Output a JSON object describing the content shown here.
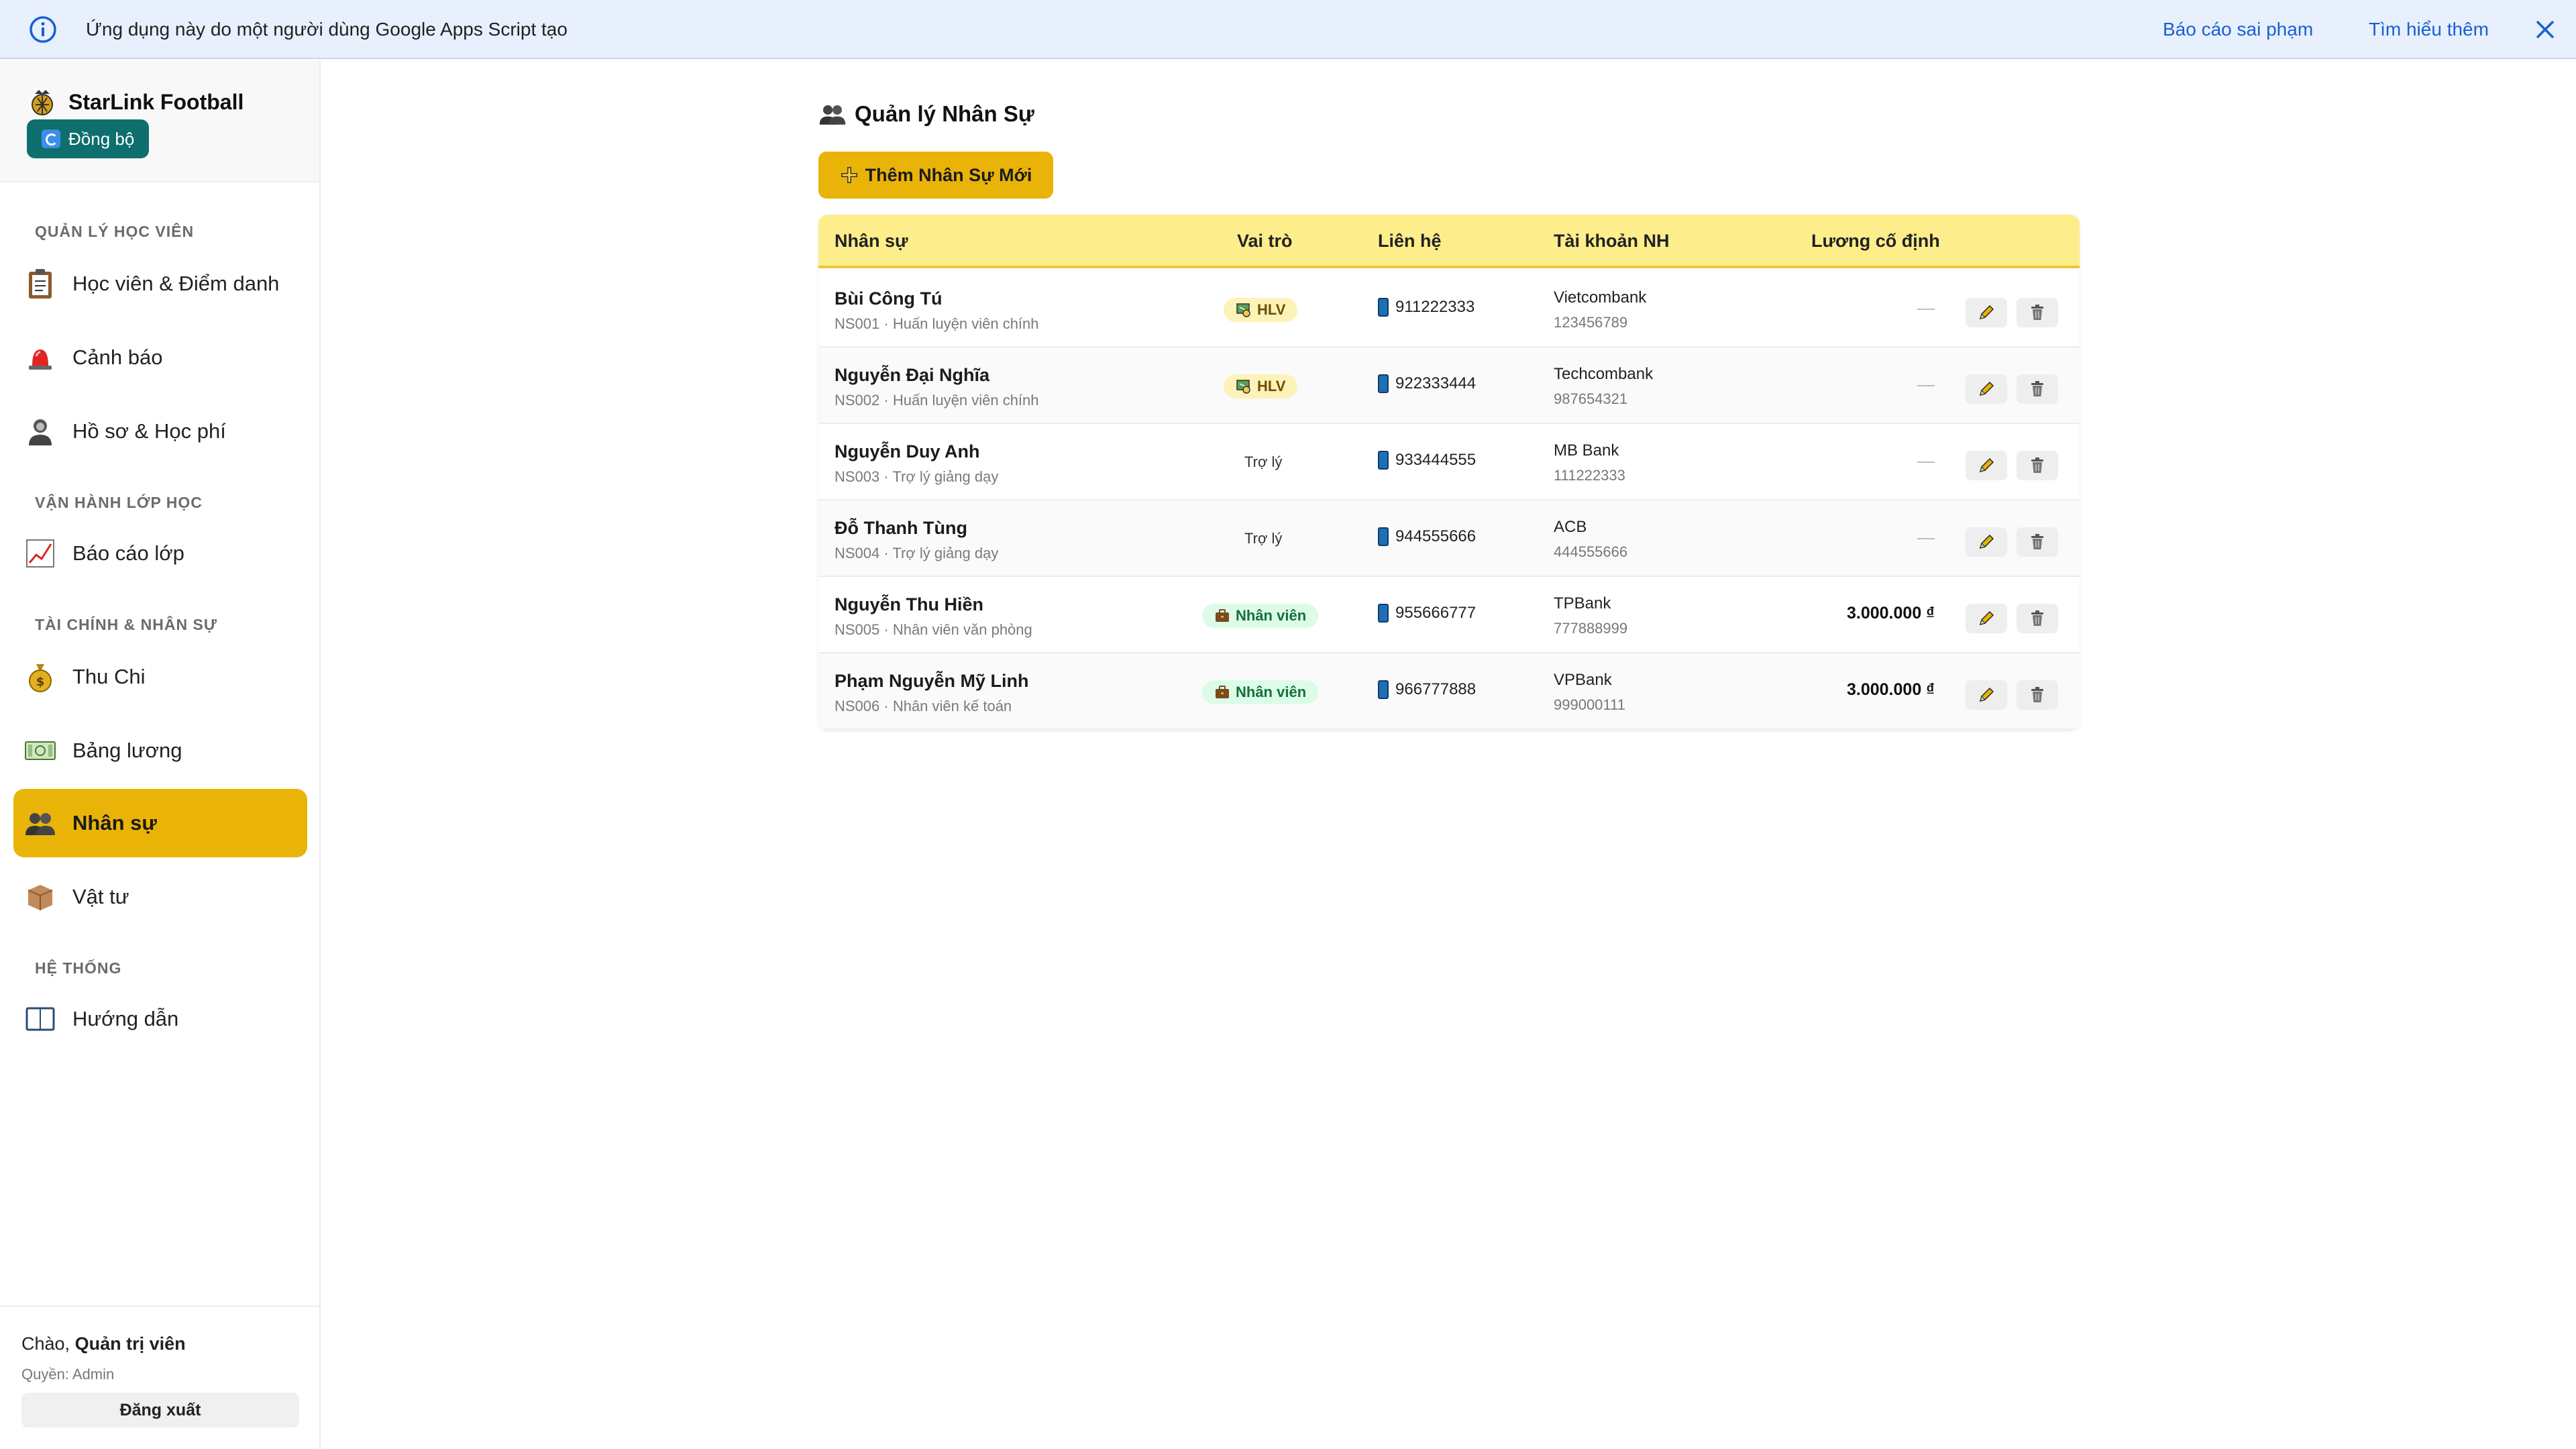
{
  "banner": {
    "text": "Ứng dụng này do một người dùng Google Apps Script tạo",
    "report_link": "Báo cáo sai phạm",
    "learn_link": "Tìm hiểu thêm"
  },
  "brand": {
    "name": "StarLink Football",
    "sync_label": "Đồng bộ"
  },
  "sidebar": {
    "sections": [
      "QUẢN LÝ HỌC VIÊN",
      "VẬN HÀNH LỚP HỌC",
      "TÀI CHÍNH & NHÂN SỰ",
      "HỆ THỐNG"
    ],
    "items": [
      {
        "label": "Học viên & Điểm danh",
        "icon": "clipboard-icon"
      },
      {
        "label": "Cảnh báo",
        "icon": "siren-icon"
      },
      {
        "label": "Hồ sơ & Học phí",
        "icon": "person-icon"
      },
      {
        "label": "Báo cáo lớp",
        "icon": "chart-icon"
      },
      {
        "label": "Thu Chi",
        "icon": "money-bag-icon"
      },
      {
        "label": "Bảng lương",
        "icon": "cash-icon"
      },
      {
        "label": "Nhân sự",
        "icon": "people-icon",
        "active": true
      },
      {
        "label": "Vật tư",
        "icon": "box-icon"
      },
      {
        "label": "Hướng dẫn",
        "icon": "book-icon"
      }
    ]
  },
  "user": {
    "greeting": "Chào,",
    "name": "Quản trị viên",
    "role": "Quyền: Admin",
    "logout_label": "Đăng xuất"
  },
  "main": {
    "title": "Quản lý Nhân Sự",
    "add_label": "Thêm Nhân Sự Mới",
    "table": {
      "headers": [
        "Nhân sự",
        "Vai trò",
        "Liên hệ",
        "Tài khoản NH",
        "Lương cố định"
      ],
      "rows": [
        {
          "name": "Bùi Công Tú",
          "sub": "NS001 · Huấn luyện viên chính",
          "role": "HLV",
          "role_type": "hlv",
          "phone": "911222333",
          "bank": "Vietcombank",
          "account": "123456789",
          "salary": ""
        },
        {
          "name": "Nguyễn Đại Nghĩa",
          "sub": "NS002 · Huấn luyện viên chính",
          "role": "HLV",
          "role_type": "hlv",
          "phone": "922333444",
          "bank": "Techcombank",
          "account": "987654321",
          "salary": ""
        },
        {
          "name": "Nguyễn Duy Anh",
          "sub": "NS003 · Trợ lý giảng dạy",
          "role": "Trợ lý",
          "role_type": "text",
          "phone": "933444555",
          "bank": "MB Bank",
          "account": "111222333",
          "salary": ""
        },
        {
          "name": "Đỗ Thanh Tùng",
          "sub": "NS004 · Trợ lý giảng dạy",
          "role": "Trợ lý",
          "role_type": "text",
          "phone": "944555666",
          "bank": "ACB",
          "account": "444555666",
          "salary": ""
        },
        {
          "name": "Nguyễn Thu Hiền",
          "sub": "NS005 · Nhân viên văn phòng",
          "role": "Nhân viên",
          "role_type": "nv",
          "phone": "955666777",
          "bank": "TPBank",
          "account": "777888999",
          "salary": "3.000.000 ₫"
        },
        {
          "name": "Phạm Nguyễn Mỹ Linh",
          "sub": "NS006 · Nhân viên kế toán",
          "role": "Nhân viên",
          "role_type": "nv",
          "phone": "966777888",
          "bank": "VPBank",
          "account": "999000111",
          "salary": "3.000.000 ₫"
        }
      ]
    }
  },
  "colors": {
    "accent": "#eab308",
    "header_bg": "#fdee8b",
    "sync_bg": "#0f6e6e",
    "banner_bg": "#e8f0fe",
    "link": "#1a5fd0"
  }
}
